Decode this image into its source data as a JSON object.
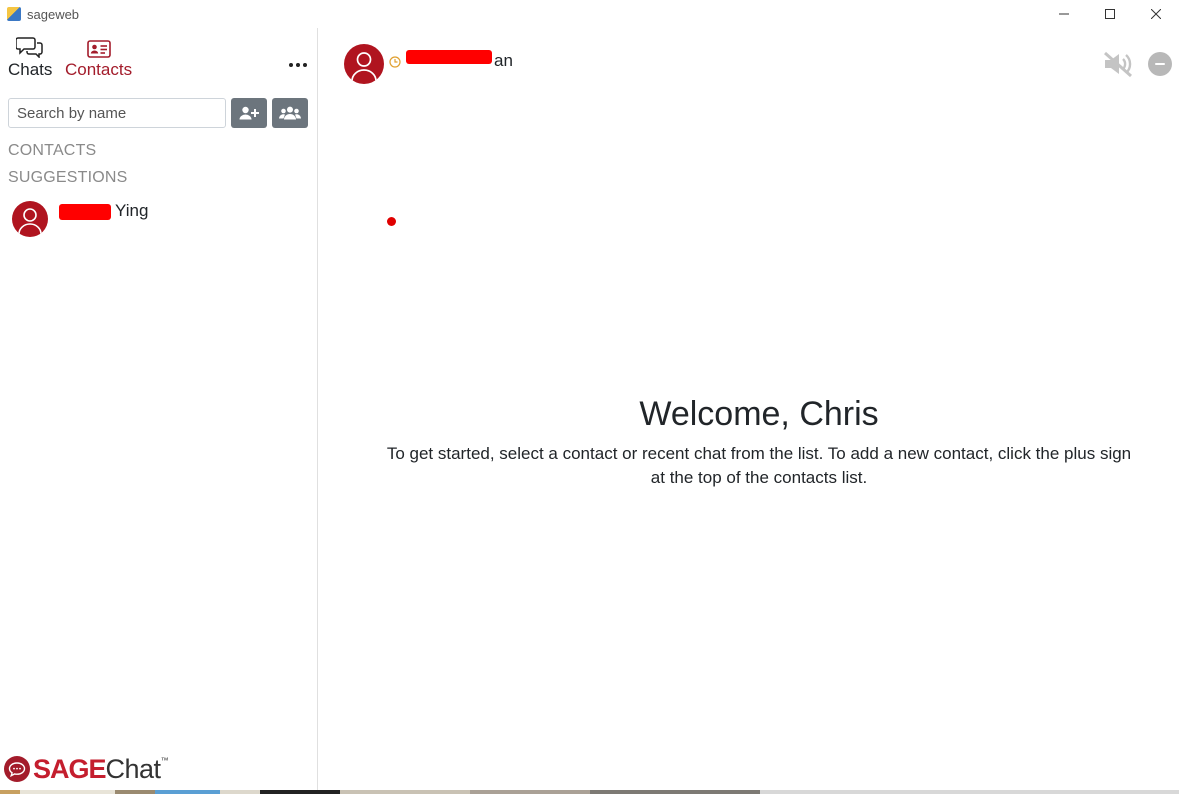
{
  "window": {
    "title": "sageweb",
    "controls": [
      "minimize",
      "maximize",
      "close"
    ]
  },
  "sidebar": {
    "tabs": [
      {
        "label": "Chats",
        "icon": "chat-bubbles-icon",
        "active": false
      },
      {
        "label": "Contacts",
        "icon": "contact-card-icon",
        "active": true
      }
    ],
    "search": {
      "placeholder": "Search by name",
      "value": ""
    },
    "sections": {
      "contacts": "CONTACTS",
      "suggestions": "SUGGESTIONS"
    },
    "suggestions": [
      {
        "name": "Ying",
        "name_partly_redacted": true
      }
    ],
    "brand": {
      "part1": "SAGE",
      "part2": "Chat",
      "tm": "™"
    }
  },
  "header": {
    "user_name": "an",
    "name_partly_redacted": true,
    "status": "away"
  },
  "welcome": {
    "title": "Welcome, Chris",
    "message": "To get started, select a contact or recent chat from the list. To add a new contact, click the plus sign at the top of the contacts list."
  },
  "colors": {
    "accent": "#a31c2b",
    "avatar": "#b0141f",
    "button": "#6c757d",
    "redaction": "#ff0000",
    "status_away": "#e0a030"
  }
}
